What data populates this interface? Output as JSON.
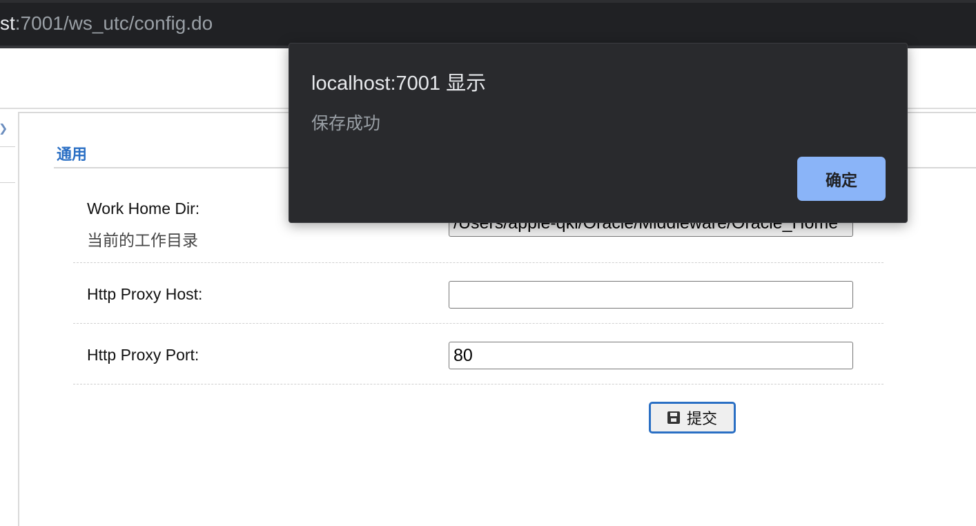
{
  "browser": {
    "url_host_fragment": "st",
    "url_rest": ":7001/ws_utc/config.do"
  },
  "nav": {
    "arrow_icon": "chevron-right-icon"
  },
  "section": {
    "title": "通用"
  },
  "fields": [
    {
      "label": "Work Home Dir:",
      "sublabel": "当前的工作目录",
      "value": "/Users/apple-qkl/Oracle/Middleware/Oracle_Home"
    },
    {
      "label": "Http Proxy Host:",
      "value": ""
    },
    {
      "label": "Http Proxy Port:",
      "value": "80"
    }
  ],
  "submit": {
    "label": "提交",
    "icon": "save-icon"
  },
  "dialog": {
    "title": "localhost:7001 显示",
    "message": "保存成功",
    "ok_label": "确定"
  },
  "colors": {
    "accent": "#2a6fc4",
    "dialog_bg": "#292a2d",
    "dialog_button": "#8ab4f8"
  }
}
